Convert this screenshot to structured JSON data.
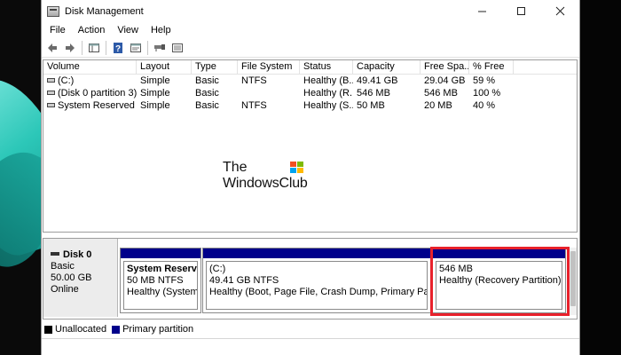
{
  "window": {
    "title": "Disk Management",
    "app_icon": "disk-management-icon"
  },
  "menu": [
    {
      "label": "File"
    },
    {
      "label": "Action"
    },
    {
      "label": "View"
    },
    {
      "label": "Help"
    }
  ],
  "volume_table": {
    "columns": [
      "Volume",
      "Layout",
      "Type",
      "File System",
      "Status",
      "Capacity",
      "Free Spa...",
      "% Free"
    ],
    "rows": [
      {
        "volume": "(C:)",
        "layout": "Simple",
        "type": "Basic",
        "fs": "NTFS",
        "status": "Healthy (B...",
        "capacity": "49.41 GB",
        "free": "29.04 GB",
        "pct": "59 %"
      },
      {
        "volume": "(Disk 0 partition 3)",
        "layout": "Simple",
        "type": "Basic",
        "fs": "",
        "status": "Healthy (R...",
        "capacity": "546 MB",
        "free": "546 MB",
        "pct": "100 %"
      },
      {
        "volume": "System Reserved",
        "layout": "Simple",
        "type": "Basic",
        "fs": "NTFS",
        "status": "Healthy (S...",
        "capacity": "50 MB",
        "free": "20 MB",
        "pct": "40 %"
      }
    ]
  },
  "watermark": {
    "line1": "The",
    "line2": "WindowsClub"
  },
  "disk": {
    "name": "Disk 0",
    "type": "Basic",
    "size": "50.00 GB",
    "state": "Online",
    "partitions": [
      {
        "title": "System Reserved",
        "size": "50 MB NTFS",
        "status": "Healthy (System, A"
      },
      {
        "title": "(C:)",
        "size": "49.41 GB NTFS",
        "status": "Healthy (Boot, Page File, Crash Dump, Primary Partition)"
      },
      {
        "title": "",
        "size": "546 MB",
        "status": "Healthy (Recovery Partition)"
      }
    ]
  },
  "legend": [
    {
      "label": "Unallocated",
      "color": "#000000"
    },
    {
      "label": "Primary partition",
      "color": "#00008b"
    }
  ],
  "colors": {
    "primary_partition": "#00008b",
    "highlight": "#e8212b"
  }
}
